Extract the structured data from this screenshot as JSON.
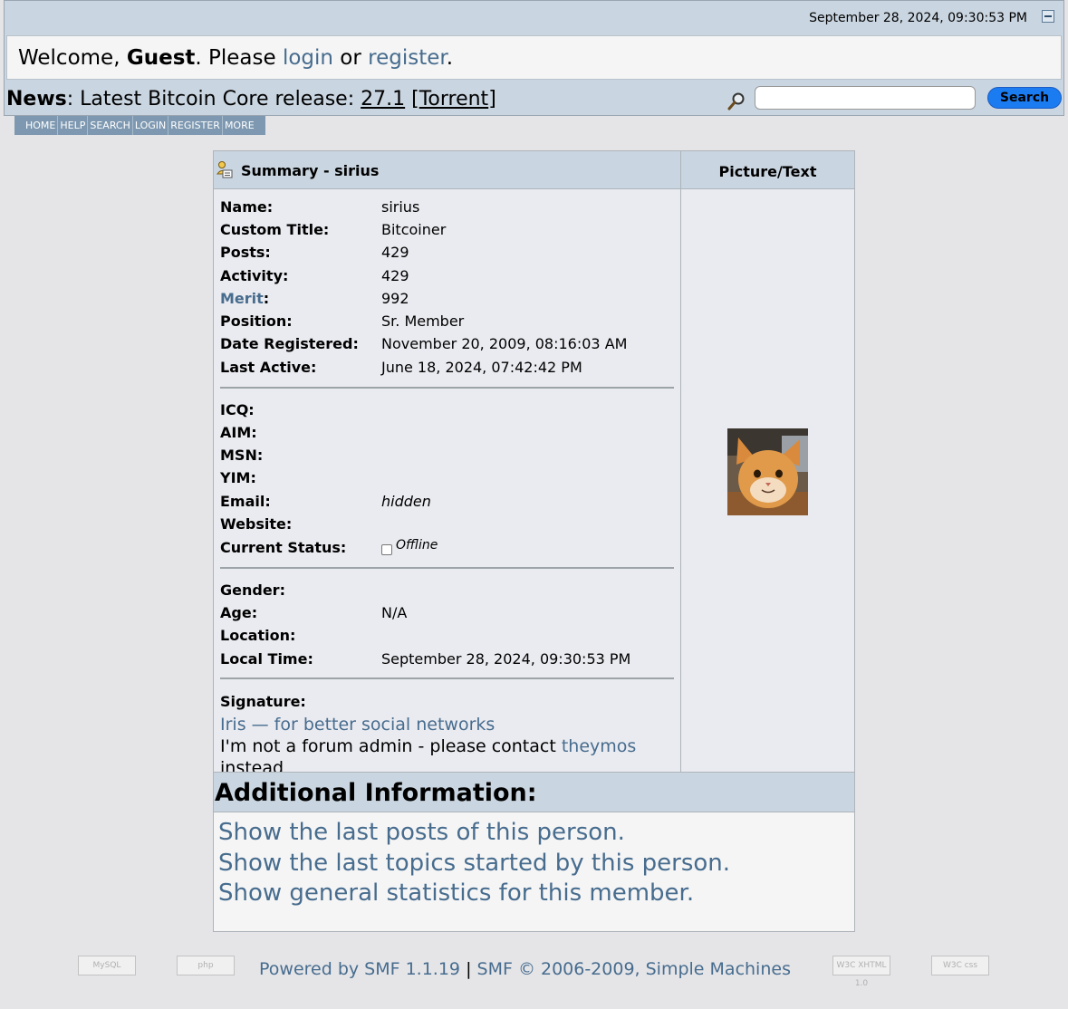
{
  "header": {
    "datetime": "September 28, 2024, 09:30:53 PM",
    "welcome": {
      "prefix": "Welcome, ",
      "user": "Guest",
      "middle": ". Please ",
      "login": "login",
      "or": " or ",
      "register": "register",
      "suffix": "."
    },
    "news": {
      "label": "News",
      "text": ": Latest Bitcoin Core release: ",
      "version": "27.1",
      "torrent_open": " [",
      "torrent": "Torrent",
      "torrent_close": "]"
    },
    "search_button": "Search",
    "search_placeholder": ""
  },
  "menu": [
    "HOME",
    "HELP",
    "SEARCH",
    "LOGIN",
    "REGISTER",
    "MORE"
  ],
  "profile": {
    "summary_title": "Summary - sirius",
    "picture_title": "Picture/Text",
    "fields": [
      {
        "label": "Name:",
        "value": "sirius"
      },
      {
        "label": "Custom Title:",
        "value": "Bitcoiner"
      },
      {
        "label": "Posts:",
        "value": "429"
      },
      {
        "label": "Activity:",
        "value": "429"
      },
      {
        "label": "Merit",
        "suffix": ":",
        "value": "992"
      },
      {
        "label": "Position:",
        "value": "Sr. Member"
      },
      {
        "label": "Date Registered:",
        "value": "November 20, 2009, 08:16:03 AM"
      },
      {
        "label": "Last Active:",
        "value": "June 18, 2024, 07:42:42 PM"
      }
    ],
    "contact": [
      {
        "label": "ICQ:",
        "value": ""
      },
      {
        "label": "AIM:",
        "value": ""
      },
      {
        "label": "MSN:",
        "value": ""
      },
      {
        "label": "YIM:",
        "value": ""
      },
      {
        "label": "Email:",
        "value": "hidden"
      },
      {
        "label": "Website:",
        "value": ""
      },
      {
        "label": "Current Status:",
        "value": "Offline"
      }
    ],
    "personal": [
      {
        "label": "Gender:",
        "value": ""
      },
      {
        "label": "Age:",
        "value": "N/A"
      },
      {
        "label": "Location:",
        "value": ""
      },
      {
        "label": "Local Time:",
        "value": "September 28, 2024, 09:30:53 PM"
      }
    ],
    "signature": {
      "label": "Signature:",
      "link": "Iris — for better social networks",
      "line2_text": "I'm not a forum admin - please contact ",
      "line2_link": "theymos",
      "line3_partial": "instead"
    }
  },
  "additional": {
    "title": "Additional Information:",
    "links": [
      "Show the last posts of this person.",
      "Show the last topics started by this person.",
      "Show general statistics for this member."
    ]
  },
  "footer": {
    "powered": "Powered by SMF 1.1.19",
    "sep": " | ",
    "copyright": "SMF © 2006-2009, Simple Machines",
    "badges": [
      "MySQL",
      "php",
      "W3C XHTML 1.0",
      "W3C css"
    ]
  },
  "colors": {
    "header_bg": "#c9d5e0",
    "link": "#476c8e",
    "menu_bg": "#7d98b0",
    "search_btn": "#1a7cf0"
  }
}
